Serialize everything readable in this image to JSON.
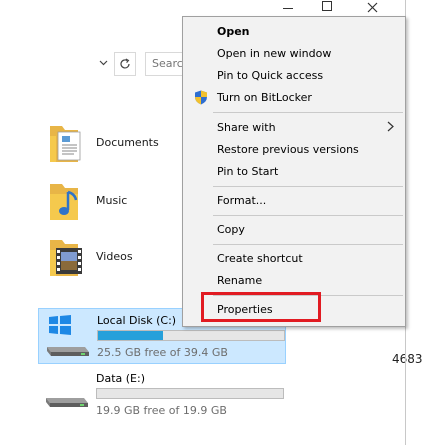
{
  "window_controls": {
    "minimize": "—",
    "maximize": "☐",
    "close": "✕"
  },
  "toolbar": {
    "search_placeholder": "Searc"
  },
  "libraries": [
    {
      "label": "Documents",
      "icon": "documents-folder-icon"
    },
    {
      "label": "Music",
      "icon": "music-folder-icon"
    },
    {
      "label": "Videos",
      "icon": "videos-folder-icon"
    }
  ],
  "drives": [
    {
      "name": "Local Disk (C:)",
      "free_text": "25.5 GB free of 39.4 GB",
      "used_fraction": 0.35,
      "selected": true
    },
    {
      "name": "Data (E:)",
      "free_text": "19.9 GB free of 19.9 GB",
      "used_fraction": 0.0,
      "selected": false
    }
  ],
  "partial_text": "4683",
  "context_menu": {
    "items": [
      {
        "label": "Open"
      },
      {
        "label": "Open in new window"
      },
      {
        "label": "Pin to Quick access"
      },
      {
        "label": "Turn on BitLocker"
      },
      {
        "label": "Share with"
      },
      {
        "label": "Restore previous versions"
      },
      {
        "label": "Pin to Start"
      },
      {
        "label": "Format..."
      },
      {
        "label": "Copy"
      },
      {
        "label": "Create shortcut"
      },
      {
        "label": "Rename"
      },
      {
        "label": "Properties"
      }
    ]
  },
  "colors": {
    "highlight": "#e11b22",
    "selection_bg": "#cce8ff",
    "progress_fill": "#26a0da"
  }
}
